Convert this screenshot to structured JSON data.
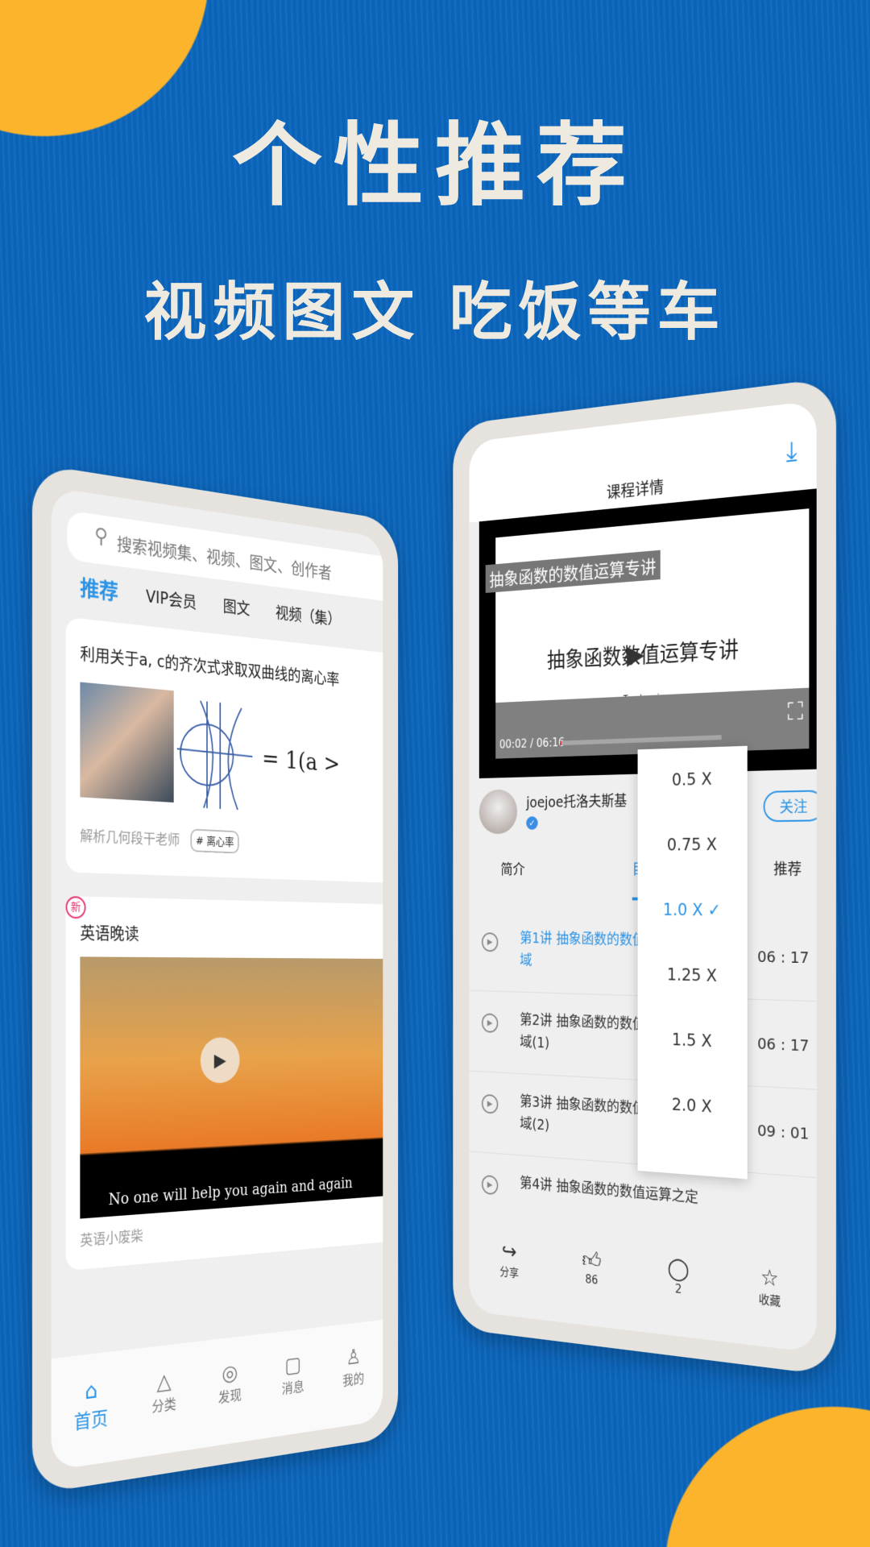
{
  "headline": "个性推荐",
  "subheadline": "视频图文 吃饭等车",
  "colors": {
    "background": "#0b66bd",
    "accent_circle": "#fbb42b",
    "app_accent": "#2a93e6"
  },
  "home": {
    "search_placeholder": "搜索视频集、视频、图文、创作者",
    "search_icon": "search-icon",
    "tabs": [
      "推荐",
      "VIP会员",
      "图文",
      "视频（集）"
    ],
    "cards": [
      {
        "title": "利用关于a, c的齐次式求取双曲线的离心率",
        "author": "解析几何段干老师",
        "tag": "# 离心率",
        "formula": "= 1(a >"
      },
      {
        "badge": "新",
        "title": "英语晚读",
        "subtitle": "No one will help you again and again",
        "author": "英语小废柴"
      }
    ],
    "nav": [
      {
        "label": "首页",
        "icon": "home-icon"
      },
      {
        "label": "分类",
        "icon": "category-icon"
      },
      {
        "label": "发现",
        "icon": "compass-icon"
      },
      {
        "label": "消息",
        "icon": "message-icon"
      },
      {
        "label": "我的",
        "icon": "user-icon"
      }
    ]
  },
  "detail": {
    "title": "课程详情",
    "video": {
      "overlay_title": "抽象函数的数值运算专讲",
      "slide_title": "抽象函数数值运算专讲",
      "teacher": "Teacher: joe",
      "time": "00:02 / 06:16",
      "progress": 0.5
    },
    "author": "joejoe托洛夫斯基",
    "follow": "关注",
    "tabs": [
      "简介",
      "目录",
      "推荐"
    ],
    "lessons": [
      {
        "title": "第1讲 抽象函数的数值运算之定义域",
        "duration": "06 : 17"
      },
      {
        "title": "第2讲 抽象函数的数值运算之定义域(1)",
        "duration": "06 : 17"
      },
      {
        "title": "第3讲 抽象函数的数值运算之定义域(2)",
        "duration": "09 : 01"
      },
      {
        "title": "第4讲 抽象函数的数值运算之定",
        "duration": ""
      }
    ],
    "bottom": [
      {
        "label": "分享",
        "icon": "share-icon"
      },
      {
        "label": "86",
        "icon": "thumbs-up-icon"
      },
      {
        "label": "2",
        "icon": "comment-icon"
      },
      {
        "label": "收藏",
        "icon": "star-icon"
      }
    ],
    "speed_options": [
      "0.5 X",
      "0.75 X",
      "1.0 X ✓",
      "1.25 X",
      "1.5 X",
      "2.0 X"
    ],
    "selected_speed": "1.0 X"
  }
}
